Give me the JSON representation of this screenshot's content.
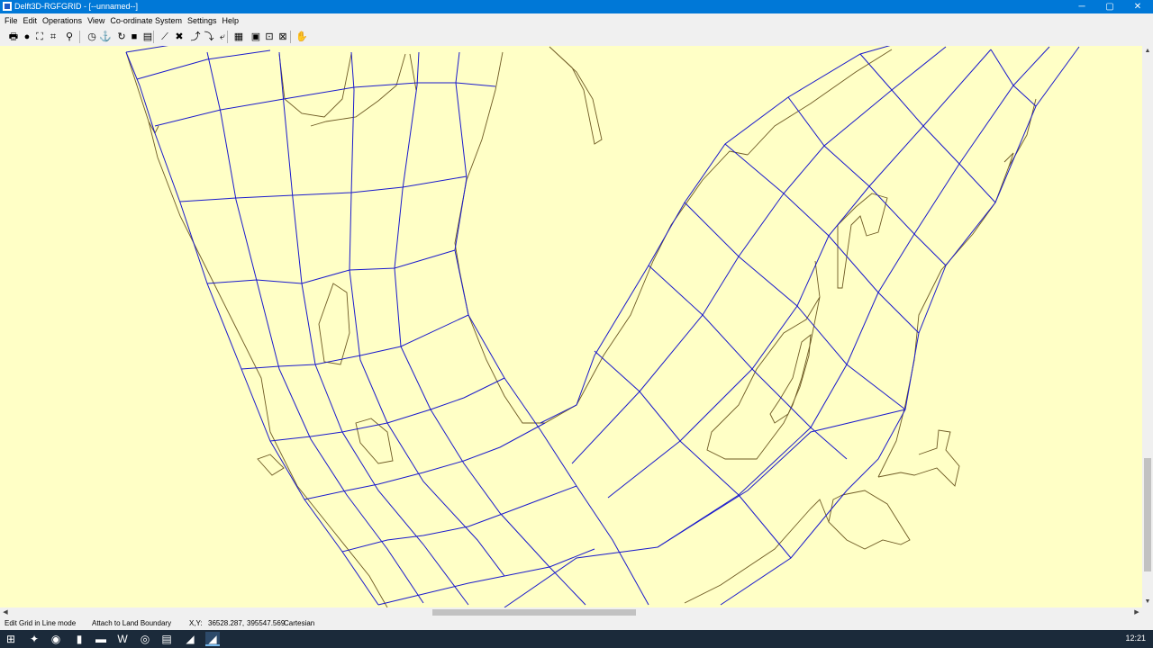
{
  "window": {
    "title": "Delft3D-RGFGRID - [--unnamed--]",
    "controls": {
      "minimize": "─",
      "maximize": "▢",
      "close": "✕"
    }
  },
  "menu": [
    "File",
    "Edit",
    "Operations",
    "View",
    "Co-ordinate System",
    "Settings",
    "Help"
  ],
  "toolbar": [
    {
      "name": "print-icon",
      "glyph": "🖶"
    },
    {
      "name": "globe-icon",
      "glyph": "●"
    },
    {
      "name": "zoom-fit-icon",
      "glyph": "⛶"
    },
    {
      "name": "zoom-box-icon",
      "glyph": "⌗"
    },
    {
      "name": "zoom-magnifier-icon",
      "glyph": "⚲"
    },
    {
      "name": "clock-icon",
      "glyph": "◷"
    },
    {
      "name": "anchor-icon",
      "glyph": "⚓"
    },
    {
      "name": "refresh-icon",
      "glyph": "↻"
    },
    {
      "name": "block-icon",
      "glyph": "■"
    },
    {
      "name": "list-icon",
      "glyph": "▤"
    },
    {
      "name": "spline-icon",
      "glyph": "⟋"
    },
    {
      "name": "delete-spline-icon",
      "glyph": "✖"
    },
    {
      "name": "insert-point-icon",
      "glyph": "⤴"
    },
    {
      "name": "move-point-icon",
      "glyph": "⤵"
    },
    {
      "name": "delete-point-icon",
      "glyph": "⤶"
    },
    {
      "name": "grid-icon",
      "glyph": "▦"
    },
    {
      "name": "grid-properties-icon",
      "glyph": "▣"
    },
    {
      "name": "grid-zoom-icon",
      "glyph": "⊡"
    },
    {
      "name": "grid-delete-icon",
      "glyph": "⊠"
    },
    {
      "name": "help-icon",
      "glyph": "✋"
    }
  ],
  "canvas": {
    "background": "#ffffc6",
    "grid_color": "#1a1acc",
    "land_boundary_color": "#6e5a24"
  },
  "status": {
    "mode": "Edit Grid in Line mode",
    "attach": "Attach to Land Boundary",
    "xy_label": "X,Y:",
    "x": "36528.287,",
    "y": "395547.569",
    "coord_system": "Cartesian"
  },
  "taskbar": {
    "apps": [
      {
        "name": "start-icon",
        "glyph": "⊞"
      },
      {
        "name": "acrobat-icon",
        "glyph": "✦"
      },
      {
        "name": "chrome-icon",
        "glyph": "◉"
      },
      {
        "name": "notes-icon",
        "glyph": "▮"
      },
      {
        "name": "explorer-icon",
        "glyph": "▬"
      },
      {
        "name": "word-icon",
        "glyph": "W"
      },
      {
        "name": "app-circle-icon",
        "glyph": "◎"
      },
      {
        "name": "notepad-icon",
        "glyph": "▤"
      },
      {
        "name": "delft3d-icon",
        "glyph": "◢"
      },
      {
        "name": "rgfgrid-icon",
        "glyph": "◢"
      }
    ],
    "clock": "12:21"
  }
}
